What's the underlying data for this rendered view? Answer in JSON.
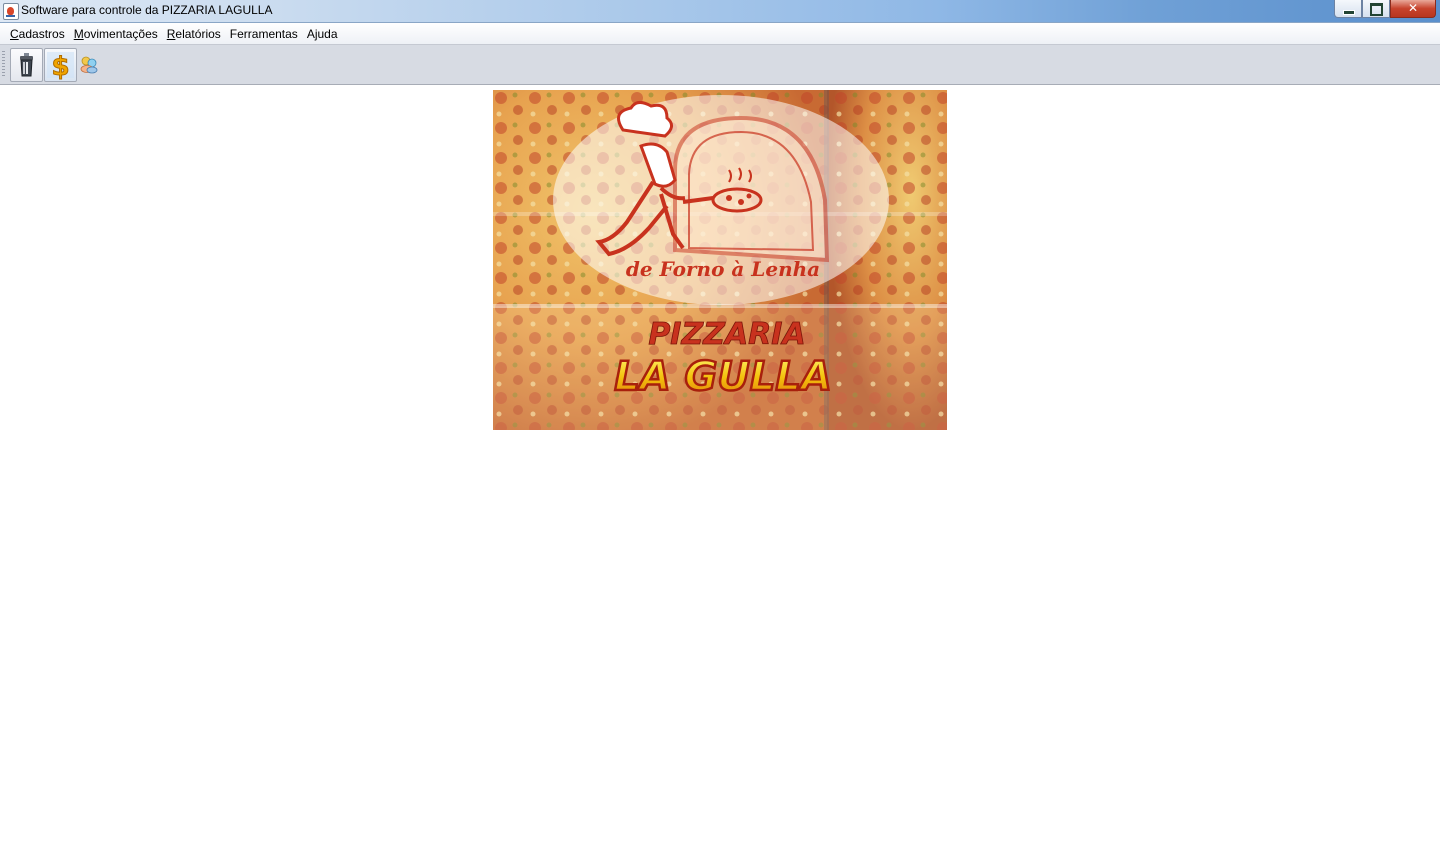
{
  "window": {
    "title": "Software para controle da PIZZARIA LAGULLA",
    "icon": "java-cup-icon",
    "controls": {
      "minimize": "minimize-icon",
      "maximize": "restore-icon",
      "close": "close-icon"
    }
  },
  "menubar": {
    "items": [
      {
        "mnemonic": "C",
        "rest": "adastros"
      },
      {
        "mnemonic": "M",
        "rest": "ovimentações"
      },
      {
        "mnemonic": "R",
        "rest": "elatórios"
      },
      {
        "mnemonic": "",
        "rest": "Ferramentas"
      },
      {
        "mnemonic": "",
        "rest": "Ajuda"
      }
    ]
  },
  "toolbar": {
    "buttons": [
      {
        "icon": "trash-bin-icon"
      },
      {
        "icon": "dollar-sign-icon"
      },
      {
        "icon": "users-icon"
      }
    ]
  },
  "logo": {
    "tagline": "de Forno à Lenha",
    "brand_line1": "PIZZARIA",
    "brand_line2": "LA GULLA",
    "colors": {
      "red": "#c8321e",
      "yellow": "#f5d10e",
      "pizza_bg": "#e6a855"
    }
  }
}
